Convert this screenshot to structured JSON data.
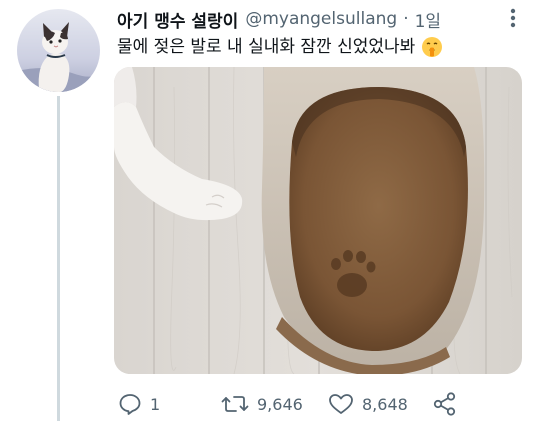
{
  "tweet": {
    "display_name": "아기 맹수 설랑이",
    "handle": "@myangelsullang",
    "separator": "·",
    "time": "1일",
    "text": "물에 젖은 발로 내 실내화 잠깐 신었었나봐",
    "emoji": "shushing-face-emoji"
  },
  "actions": {
    "reply_count": "1",
    "retweet_count": "9,646",
    "like_count": "8,648"
  },
  "colors": {
    "secondary_text": "#536471",
    "thread_line": "#cfd9de"
  },
  "icons": [
    "more-icon",
    "reply-icon",
    "retweet-icon",
    "like-icon",
    "share-icon"
  ]
}
